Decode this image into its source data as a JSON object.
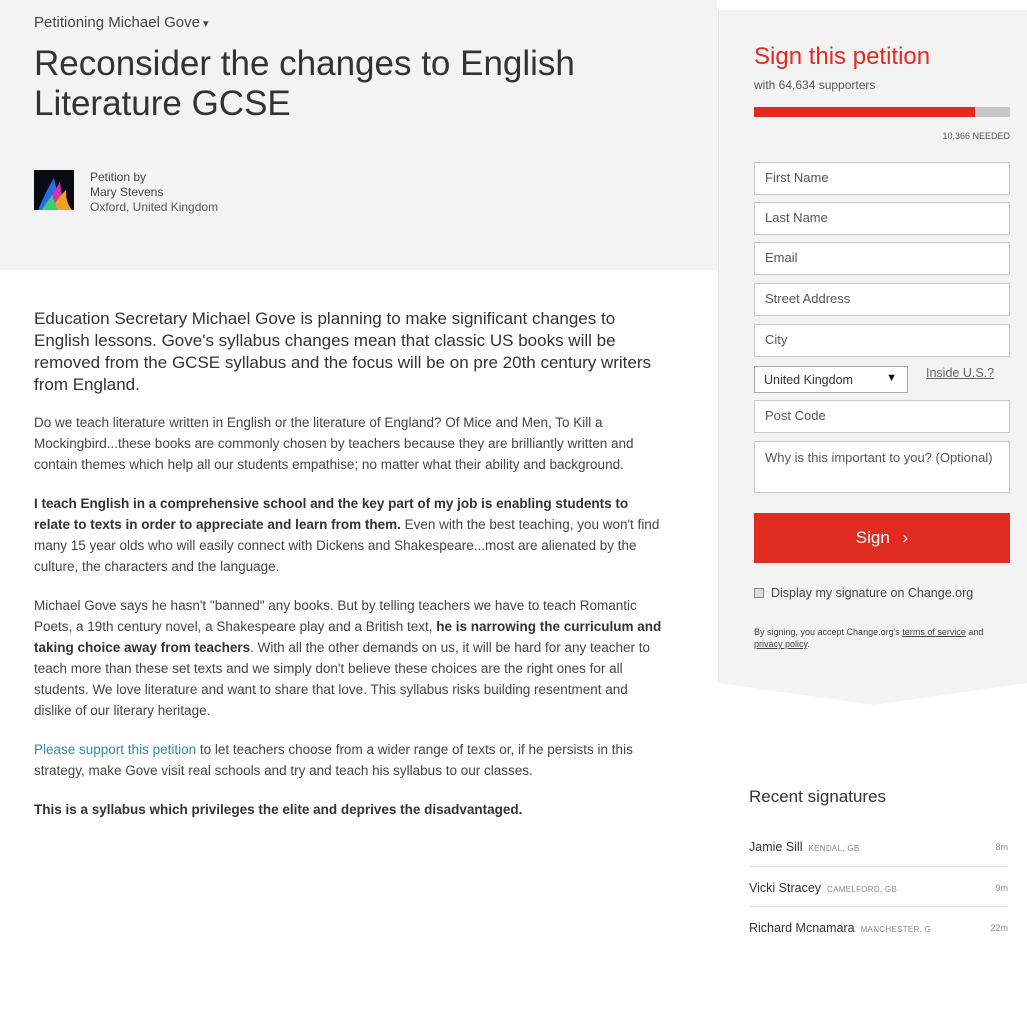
{
  "petition": {
    "petitioning": "Petitioning Michael Gove",
    "title": "Reconsider the changes to English Literature GCSE",
    "author": {
      "label": "Petition by",
      "name": "Mary Stevens",
      "location": "Oxford, United Kingdom"
    }
  },
  "article": {
    "lede": "Education Secretary Michael Gove is planning to make significant changes to English lessons. Gove's syllabus changes mean that classic US books will be removed from the GCSE syllabus and the focus will be on pre 20th century writers from England.",
    "p1": "Do we teach literature written in English or the literature of England? Of Mice and Men, To Kill a Mockingbird...these books are commonly chosen by teachers because they are brilliantly written and contain themes which help all our students empathise; no matter what their ability and background.",
    "p2_bold": "I teach English in a comprehensive school and the key part of my job is enabling students to relate to texts in order to appreciate and learn from them.",
    "p2_rest": " Even with the best teaching, you won't find many 15 year olds who will easily connect with Dickens and Shakespeare...most are alienated by the culture, the characters and the language.",
    "p3_a": "Michael Gove says he hasn't \"banned\" any books. But by telling teachers we have to teach Romantic Poets, a 19th century novel, a Shakespeare play and a British text,",
    "p3_bold": " he is narrowing the curriculum and taking choice away from teachers",
    "p3_b": ". With all the other demands on us, it will be hard for any teacher to teach more than these set texts and we simply don't believe these choices are the right ones for all students. We love literature and want to share that love. This syllabus risks building resentment and dislike of our literary heritage.",
    "p4_link": "Please support this petition",
    "p4_rest": " to let teachers choose from a wider range of texts or, if he persists in this strategy, make Gove visit real schools and try and teach his syllabus to our classes.",
    "p5_bold": "This is a syllabus which privileges the elite and deprives the disadvantaged."
  },
  "sign": {
    "title": "Sign this petition",
    "supporters": "with 64,634 supporters",
    "progress_fraction": 0.862,
    "needed": "10,366 NEEDED",
    "fields": {
      "first_name": "First Name",
      "last_name": "Last Name",
      "email": "Email",
      "street": "Street Address",
      "city": "City",
      "post_code": "Post Code",
      "why": "Why is this important to you? (Optional)"
    },
    "country": "United Kingdom",
    "inside_us": "Inside U.S.?",
    "button": "Sign",
    "button_arrow": "›",
    "display_label": "Display my signature on Change.org",
    "terms_pre": "By signing, you accept Change.org's ",
    "terms_link": "terms of service",
    "terms_mid": " and ",
    "privacy_link": "privacy policy",
    "terms_end": "."
  },
  "recent": {
    "title": "Recent signatures",
    "items": [
      {
        "name": "Jamie Sill",
        "location": "KENDAL, GB",
        "time": "8m"
      },
      {
        "name": "Vicki Stracey",
        "location": "CAMELFORD, GB",
        "time": "9m"
      },
      {
        "name": "Richard Mcnamara",
        "location": "MANCHESTER, G",
        "time": "22m"
      }
    ]
  },
  "colors": {
    "accent": "#e02b20",
    "link": "#2f8aaa",
    "panel": "#f3f3f3"
  }
}
